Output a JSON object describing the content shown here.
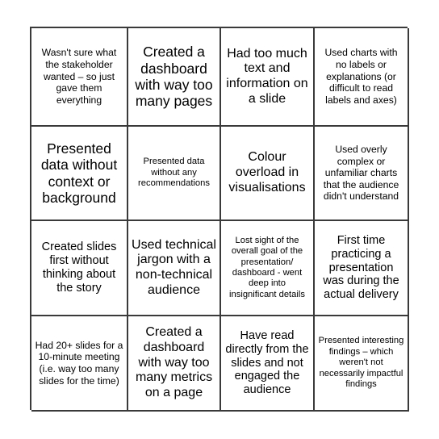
{
  "card": {
    "type": "bingo-card",
    "columns": 4,
    "rows": 4,
    "colors": {
      "background": "#ffffff",
      "border": "#3a3a3a",
      "text": "#000000"
    },
    "cells": [
      {
        "row": 1,
        "col": 1,
        "text": "Wasn't sure what the stakeholder wanted – so just gave them everything",
        "size": "sm"
      },
      {
        "row": 1,
        "col": 2,
        "text": "Created a dashboard with way too many pages",
        "size": "xl"
      },
      {
        "row": 1,
        "col": 3,
        "text": "Had too much text and information on a slide",
        "size": "lg"
      },
      {
        "row": 1,
        "col": 4,
        "text": "Used charts with no labels or explanations (or difficult to read labels and axes)",
        "size": "sm"
      },
      {
        "row": 2,
        "col": 1,
        "text": "Presented data without context or background",
        "size": "xl"
      },
      {
        "row": 2,
        "col": 2,
        "text": "Presented data without any recommendations",
        "size": "xs"
      },
      {
        "row": 2,
        "col": 3,
        "text": "Colour overload in visualisations",
        "size": "lg"
      },
      {
        "row": 2,
        "col": 4,
        "text": "Used overly complex or unfamiliar charts that the audience didn't understand",
        "size": "sm"
      },
      {
        "row": 3,
        "col": 1,
        "text": "Created slides first without thinking about the story",
        "size": "md"
      },
      {
        "row": 3,
        "col": 2,
        "text": "Used technical jargon with a non-technical audience",
        "size": "lg"
      },
      {
        "row": 3,
        "col": 3,
        "text": "Lost sight of the overall goal of the presentation/ dashboard - went deep into insignificant details",
        "size": "xs"
      },
      {
        "row": 3,
        "col": 4,
        "text": "First time practicing a presentation was during the actual delivery",
        "size": "md"
      },
      {
        "row": 4,
        "col": 1,
        "text": "Had 20+ slides for a 10-minute meeting (i.e. way too many slides for the time)",
        "size": "sm"
      },
      {
        "row": 4,
        "col": 2,
        "text": "Created a dashboard with way too many metrics on a page",
        "size": "lg"
      },
      {
        "row": 4,
        "col": 3,
        "text": "Have read directly from the slides and not engaged the audience",
        "size": "md"
      },
      {
        "row": 4,
        "col": 4,
        "text": "Presented interesting findings – which weren't not necessarily impactful findings",
        "size": "xs"
      }
    ]
  }
}
